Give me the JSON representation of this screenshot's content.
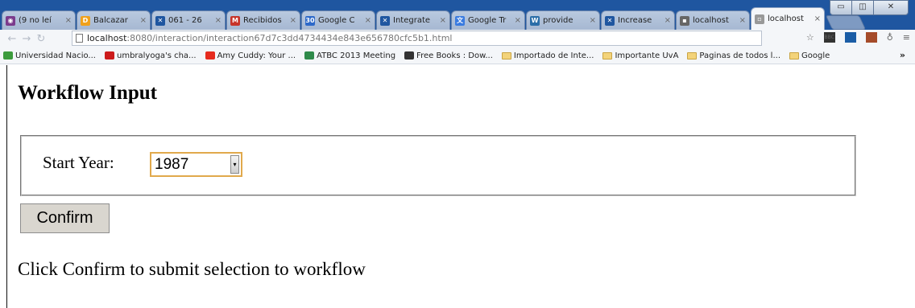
{
  "browser": {
    "tabs": [
      {
        "title": "(9 no leí",
        "icon": "chat-icon",
        "color": "#7b3b8c",
        "glyph": "◉"
      },
      {
        "title": "Balcazar",
        "icon": "document-icon",
        "color": "#f0a11b",
        "glyph": "D"
      },
      {
        "title": "061 - 26",
        "icon": "x-logo-icon",
        "color": "#1f56a0",
        "glyph": "✕"
      },
      {
        "title": "Recibidos",
        "icon": "mail-icon",
        "color": "#c7342a",
        "glyph": "M"
      },
      {
        "title": "Google C",
        "icon": "calendar-icon",
        "color": "#2d69c9",
        "glyph": "30"
      },
      {
        "title": "Integrate",
        "icon": "x-logo-icon",
        "color": "#1f56a0",
        "glyph": "✕"
      },
      {
        "title": "Google Tr",
        "icon": "translate-icon",
        "color": "#3a7be0",
        "glyph": "文"
      },
      {
        "title": "provide",
        "icon": "reference-icon",
        "color": "#2b6ea8",
        "glyph": "W"
      },
      {
        "title": "Increase",
        "icon": "x-logo-icon",
        "color": "#1f56a0",
        "glyph": "✕"
      },
      {
        "title": "localhost",
        "icon": "page-icon",
        "color": "#666666",
        "glyph": "▪"
      },
      {
        "title": "localhost",
        "icon": "page-icon",
        "color": "#999999",
        "glyph": "▫"
      }
    ],
    "url_host": "localhost",
    "url_rest": ":8080/interaction/interaction67d7c3dd4734434e843e656780cfc5b1.html",
    "bookmarks": [
      {
        "label": "Universidad Nacio...",
        "icon": "university-icon",
        "kind": "icon",
        "color": "#3d9b3d"
      },
      {
        "label": "umbralyoga's cha...",
        "icon": "youtube-icon",
        "kind": "icon",
        "color": "#cc1b1b"
      },
      {
        "label": "Amy Cuddy: Your ...",
        "icon": "ted-icon",
        "kind": "icon",
        "color": "#e62b1e"
      },
      {
        "label": "ATBC 2013 Meeting",
        "icon": "bird-icon",
        "kind": "icon",
        "color": "#2f8a4a"
      },
      {
        "label": "Free Books : Dow...",
        "icon": "library-icon",
        "kind": "icon",
        "color": "#333333"
      },
      {
        "label": "Importado de Inte...",
        "icon": "folder-icon",
        "kind": "folder"
      },
      {
        "label": "Importante UvA",
        "icon": "folder-icon",
        "kind": "folder"
      },
      {
        "label": "Paginas de todos l...",
        "icon": "folder-icon",
        "kind": "folder"
      },
      {
        "label": "Google",
        "icon": "folder-icon",
        "kind": "folder"
      }
    ],
    "more_bookmarks": "»"
  },
  "page": {
    "heading": "Workflow Input",
    "field_label": "Start Year:",
    "selected_year": "1987",
    "confirm_label": "Confirm",
    "instruction": "Click Confirm to submit selection to workflow"
  }
}
